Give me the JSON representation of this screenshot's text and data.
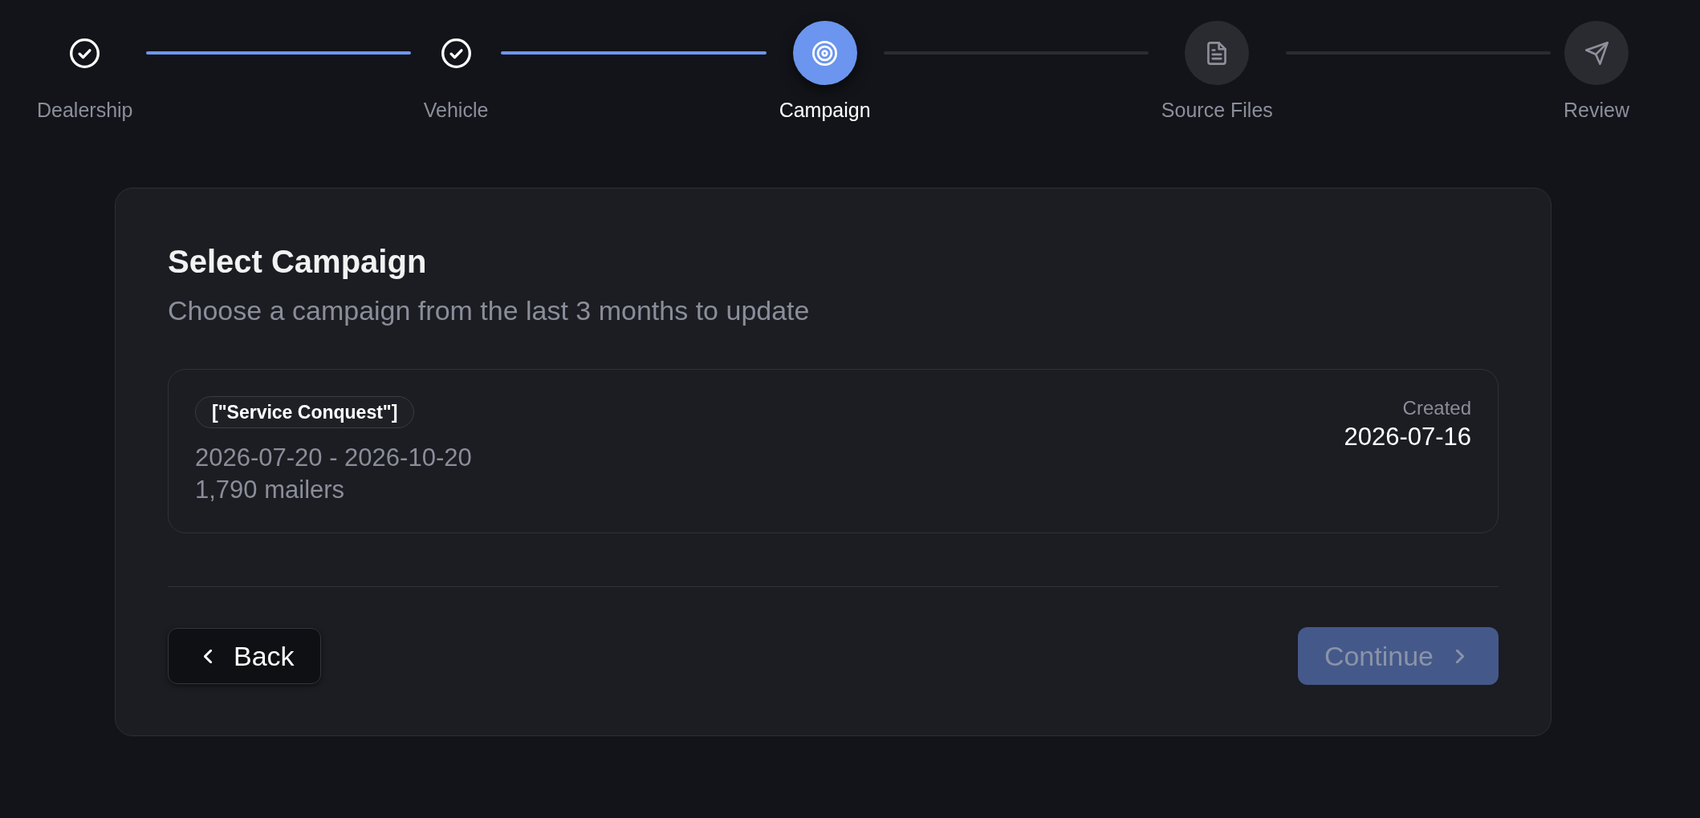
{
  "steps": [
    {
      "label": "Dealership",
      "completed": true,
      "selected": false
    },
    {
      "label": "Vehicle",
      "completed": true,
      "selected": false
    },
    {
      "label": "Campaign",
      "completed": false,
      "selected": true
    },
    {
      "label": "Source Files",
      "completed": false,
      "selected": false
    },
    {
      "label": "Review",
      "completed": false,
      "selected": false
    }
  ],
  "panel": {
    "title": "Select Campaign",
    "subtitle": "Choose a campaign from the last 3 months to update",
    "campaigns": [
      {
        "tag": "[\"Service Conquest\"]",
        "dates": "2026-07-20 - 2026-10-20",
        "mailers": "1,790 mailers",
        "created_label": "Created",
        "created": "2026-07-16",
        "selected": false
      }
    ],
    "buttons": [
      {
        "label": "Back",
        "kind": "back",
        "disabled": false
      },
      {
        "label": "Continue",
        "kind": "continue",
        "disabled": true
      }
    ]
  }
}
